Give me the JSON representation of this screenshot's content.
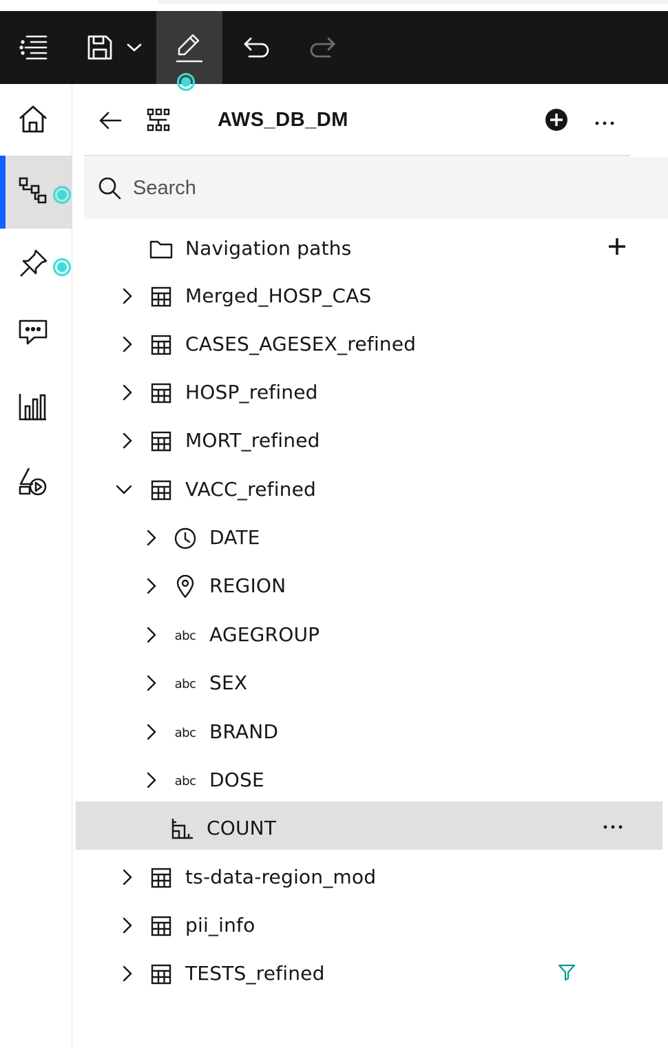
{
  "toolbar": {
    "items": [
      {
        "name": "menu-icon"
      },
      {
        "name": "save-icon"
      },
      {
        "name": "chevron-down-icon"
      },
      {
        "name": "edit-pencil-icon"
      },
      {
        "name": "undo-icon"
      },
      {
        "name": "redo-icon"
      }
    ]
  },
  "leftnav": {
    "items": [
      {
        "name": "home-icon"
      },
      {
        "name": "data-tree-icon"
      },
      {
        "name": "pin-icon"
      },
      {
        "name": "chat-icon"
      },
      {
        "name": "visualizations-icon"
      },
      {
        "name": "shapes-icon"
      }
    ]
  },
  "panel": {
    "title": "AWS_DB_DM",
    "search": {
      "placeholder": "Search"
    }
  },
  "tree": {
    "navigation_paths": "Navigation paths",
    "items": [
      {
        "label": "Merged_HOSP_CAS",
        "type": "table"
      },
      {
        "label": "CASES_AGESEX_refined",
        "type": "table"
      },
      {
        "label": "HOSP_refined",
        "type": "table"
      },
      {
        "label": "MORT_refined",
        "type": "table"
      },
      {
        "label": "VACC_refined",
        "type": "table",
        "expanded": true
      },
      {
        "label": "DATE",
        "type": "time"
      },
      {
        "label": "REGION",
        "type": "location"
      },
      {
        "label": "AGEGROUP",
        "type": "text"
      },
      {
        "label": "SEX",
        "type": "text"
      },
      {
        "label": "BRAND",
        "type": "text"
      },
      {
        "label": "DOSE",
        "type": "text"
      },
      {
        "label": "COUNT",
        "type": "measure",
        "selected": true
      },
      {
        "label": "ts-data-region_mod",
        "type": "table"
      },
      {
        "label": "pii_info",
        "type": "table"
      },
      {
        "label": "TESTS_refined",
        "type": "table",
        "filtered": true
      }
    ],
    "abc_label": "abc"
  },
  "colors": {
    "toolbar_bg": "#161616",
    "accent_blue": "#0f62fe",
    "teal_indicator": "#3ddbd9",
    "filter_icon": "#009d9a",
    "selected_row": "#e0e0e0"
  }
}
